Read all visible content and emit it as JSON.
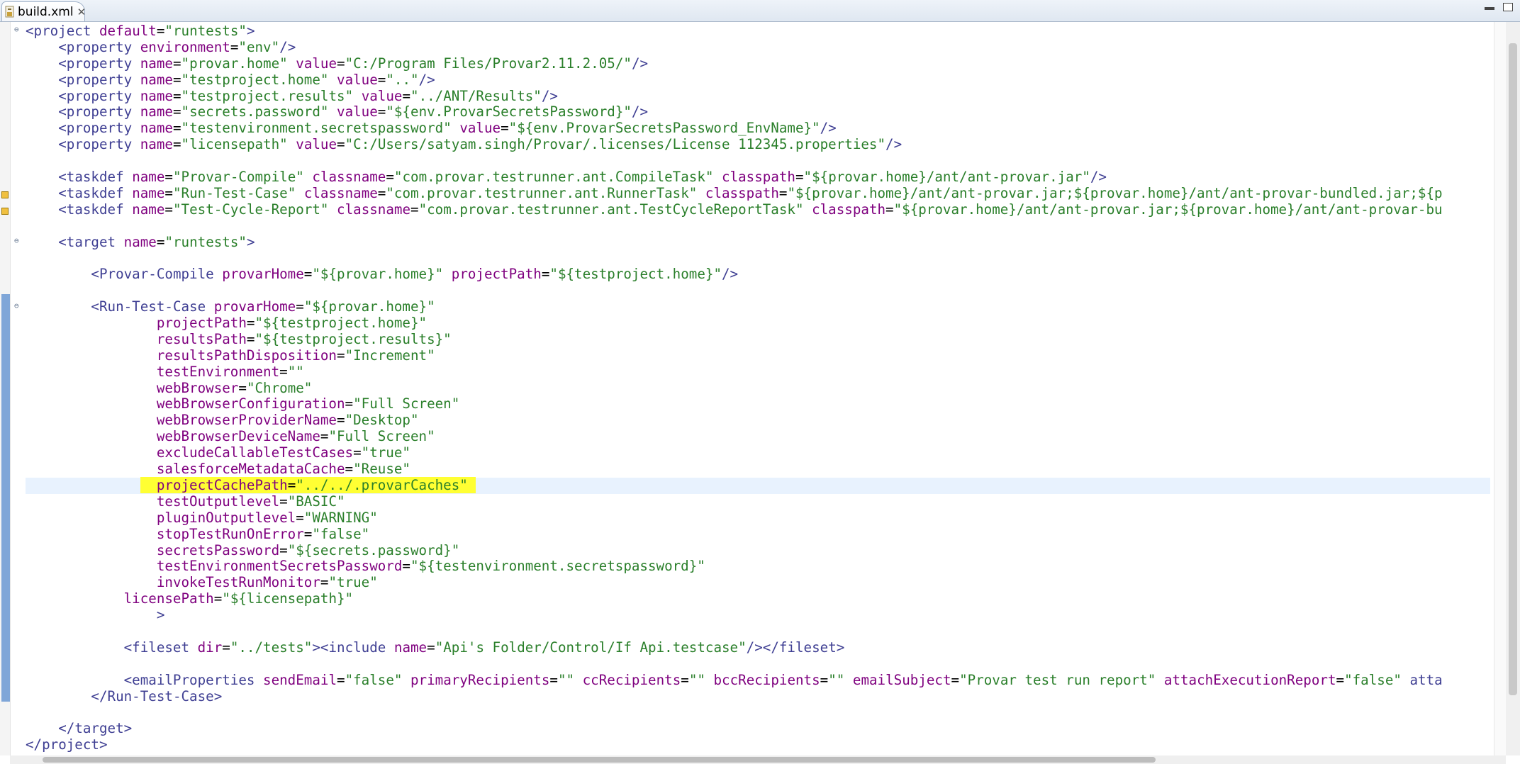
{
  "tab": {
    "title": "build.xml",
    "close_glyph": "✕"
  },
  "lines": [
    {
      "text": "<project default=\"runtests\">"
    },
    {
      "text": "    <property environment=\"env\"/>"
    },
    {
      "text": "    <property name=\"provar.home\" value=\"C:/Program Files/Provar2.11.2.05/\"/>"
    },
    {
      "text": "    <property name=\"testproject.home\" value=\"..\"/>"
    },
    {
      "text": "    <property name=\"testproject.results\" value=\"../ANT/Results\"/>"
    },
    {
      "text": "    <property name=\"secrets.password\" value=\"${env.ProvarSecretsPassword}\"/>"
    },
    {
      "text": "    <property name=\"testenvironment.secretspassword\" value=\"${env.ProvarSecretsPassword_EnvName}\"/>"
    },
    {
      "text": "    <property name=\"licensepath\" value=\"C:/Users/satyam.singh/Provar/.licenses/License 112345.properties\"/>"
    },
    {
      "text": ""
    },
    {
      "text": "    <taskdef name=\"Provar-Compile\" classname=\"com.provar.testrunner.ant.CompileTask\" classpath=\"${provar.home}/ant/ant-provar.jar\"/>"
    },
    {
      "text": "    <taskdef name=\"Run-Test-Case\" classname=\"com.provar.testrunner.ant.RunnerTask\" classpath=\"${provar.home}/ant/ant-provar.jar;${provar.home}/ant/ant-provar-bundled.jar;${p"
    },
    {
      "text": "    <taskdef name=\"Test-Cycle-Report\" classname=\"com.provar.testrunner.ant.TestCycleReportTask\" classpath=\"${provar.home}/ant/ant-provar.jar;${provar.home}/ant/ant-provar-bu"
    },
    {
      "text": ""
    },
    {
      "text": "    <target name=\"runtests\">"
    },
    {
      "text": ""
    },
    {
      "text": "        <Provar-Compile provarHome=\"${provar.home}\" projectPath=\"${testproject.home}\"/>"
    },
    {
      "text": ""
    },
    {
      "text": "        <Run-Test-Case provarHome=\"${provar.home}\""
    },
    {
      "text": "                projectPath=\"${testproject.home}\""
    },
    {
      "text": "                resultsPath=\"${testproject.results}\""
    },
    {
      "text": "                resultsPathDisposition=\"Increment\""
    },
    {
      "text": "                testEnvironment=\"\""
    },
    {
      "text": "                webBrowser=\"Chrome\""
    },
    {
      "text": "                webBrowserConfiguration=\"Full Screen\""
    },
    {
      "text": "                webBrowserProviderName=\"Desktop\""
    },
    {
      "text": "                webBrowserDeviceName=\"Full Screen\""
    },
    {
      "text": "                excludeCallableTestCases=\"true\""
    },
    {
      "text": "                salesforceMetadataCache=\"Reuse\""
    },
    {
      "text": "                projectCachePath=\"../../.provarCaches\" ",
      "indent": "              ",
      "highlight": true
    },
    {
      "text": "                testOutputlevel=\"BASIC\""
    },
    {
      "text": "                pluginOutputlevel=\"WARNING\""
    },
    {
      "text": "                stopTestRunOnError=\"false\""
    },
    {
      "text": "                secretsPassword=\"${secrets.password}\""
    },
    {
      "text": "                testEnvironmentSecretsPassword=\"${testenvironment.secretspassword}\""
    },
    {
      "text": "                invokeTestRunMonitor=\"true\""
    },
    {
      "text": "            licensePath=\"${licensepath}\""
    },
    {
      "text": "                >"
    },
    {
      "text": ""
    },
    {
      "text": "            <fileset dir=\"../tests\"><include name=\"Api's Folder/Control/If Api.testcase\"/></fileset>"
    },
    {
      "text": ""
    },
    {
      "text": "            <emailProperties sendEmail=\"false\" primaryRecipients=\"\" ccRecipients=\"\" bccRecipients=\"\" emailSubject=\"Provar test run report\" attachExecutionReport=\"false\" atta"
    },
    {
      "text": "        </Run-Test-Case>"
    },
    {
      "text": ""
    },
    {
      "text": "    </target>"
    },
    {
      "text": "</project>"
    }
  ],
  "colors": {
    "tag": "#3f3f93",
    "attr_name": "#7f007f",
    "attr_value": "#2a7f2a",
    "highlight": "#ffff33",
    "current_line": "#e8f2fe",
    "change_bar": "#7fa6d8",
    "warning": "#f0c040"
  },
  "icons": [
    "xml-file-icon",
    "close-icon",
    "minimize-icon",
    "maximize-icon",
    "fold-icon",
    "warning-icon"
  ]
}
